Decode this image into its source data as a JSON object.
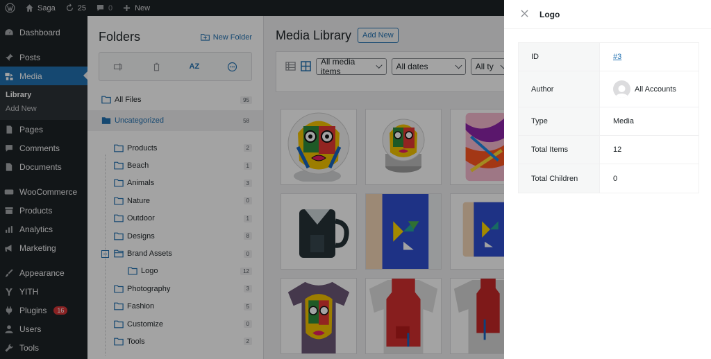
{
  "adminbar": {
    "site_name": "Saga",
    "updates_count": "25",
    "comments_count": "0",
    "new_label": "New"
  },
  "sidebar": {
    "items": [
      {
        "label": "Dashboard",
        "icon": "dashboard-icon"
      },
      {
        "label": "Posts",
        "icon": "pin-icon"
      },
      {
        "label": "Media",
        "icon": "media-icon"
      },
      {
        "label": "Pages",
        "icon": "page-icon"
      },
      {
        "label": "Comments",
        "icon": "comment-icon"
      },
      {
        "label": "Documents",
        "icon": "document-icon"
      },
      {
        "label": "WooCommerce",
        "icon": "woo-icon"
      },
      {
        "label": "Products",
        "icon": "archive-icon"
      },
      {
        "label": "Analytics",
        "icon": "chart-icon"
      },
      {
        "label": "Marketing",
        "icon": "megaphone-icon"
      },
      {
        "label": "Appearance",
        "icon": "brush-icon"
      },
      {
        "label": "YITH",
        "icon": "yith-icon"
      },
      {
        "label": "Plugins",
        "icon": "plugin-icon",
        "badge": "16"
      },
      {
        "label": "Users",
        "icon": "user-icon"
      },
      {
        "label": "Tools",
        "icon": "wrench-icon"
      }
    ],
    "media_submenu": [
      "Library",
      "Add New"
    ]
  },
  "folders": {
    "title": "Folders",
    "new_folder_label": "New Folder",
    "sort_label": "AZ",
    "tree": [
      {
        "label": "All Files",
        "count": "95"
      },
      {
        "label": "Uncategorized",
        "count": "58"
      },
      {
        "label": "Products",
        "count": "2"
      },
      {
        "label": "Beach",
        "count": "1"
      },
      {
        "label": "Animals",
        "count": "3"
      },
      {
        "label": "Nature",
        "count": "0"
      },
      {
        "label": "Outdoor",
        "count": "1"
      },
      {
        "label": "Designs",
        "count": "8"
      },
      {
        "label": "Brand Assets",
        "count": "0"
      },
      {
        "label": "Logo",
        "count": "12"
      },
      {
        "label": "Photography",
        "count": "3"
      },
      {
        "label": "Fashion",
        "count": "5"
      },
      {
        "label": "Customize",
        "count": "0"
      },
      {
        "label": "Tools",
        "count": "2"
      }
    ]
  },
  "main": {
    "title": "Media Library",
    "add_new_label": "Add New",
    "filter_media": "All media items",
    "filter_dates": "All dates",
    "filter_types": "All ty"
  },
  "panel": {
    "title": "Logo",
    "rows": [
      {
        "label": "ID",
        "value": "#3"
      },
      {
        "label": "Author",
        "value": "All Accounts"
      },
      {
        "label": "Type",
        "value": "Media"
      },
      {
        "label": "Total Items",
        "value": "12"
      },
      {
        "label": "Total Children",
        "value": "0"
      }
    ]
  },
  "colors": {
    "admin_dark": "#1d2327",
    "accent": "#2271b1",
    "badge": "#d63638"
  }
}
